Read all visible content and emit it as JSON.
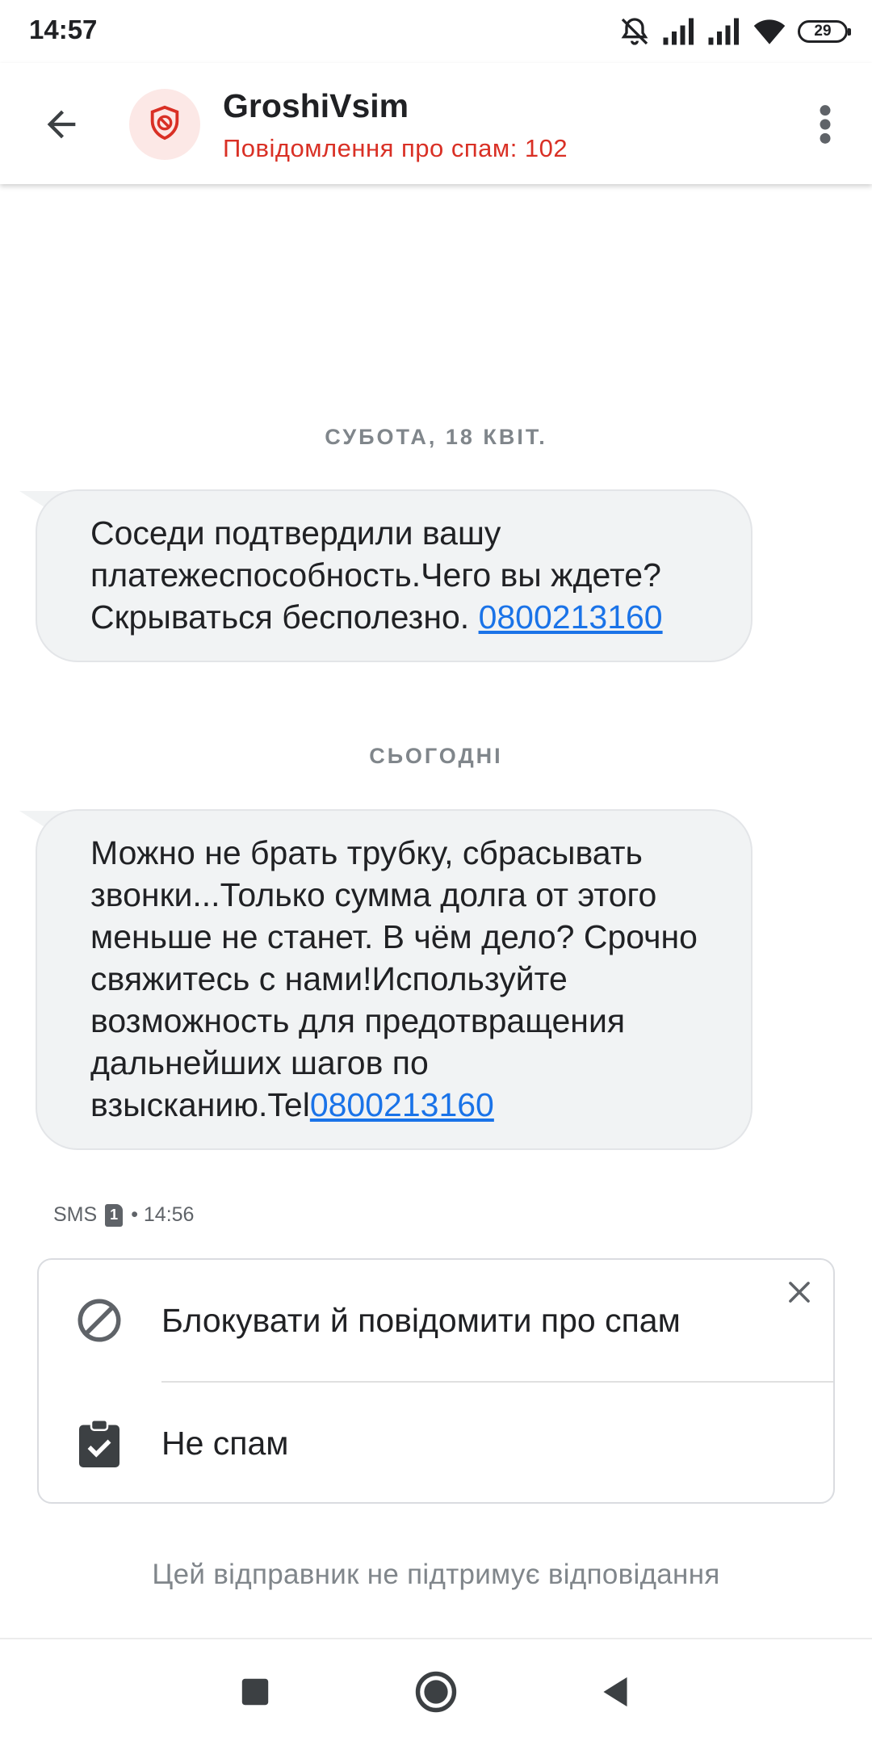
{
  "status_bar": {
    "time": "14:57",
    "battery": "29",
    "icons": [
      "alarm-off-icon",
      "signal-icon",
      "signal-icon",
      "wifi-icon",
      "battery-icon"
    ]
  },
  "app_bar": {
    "back_icon": "arrow-back-icon",
    "avatar_icon": "spam-shield-icon",
    "sender_name": "GroshiVsim",
    "spam_count": "Повідомлення про спам: 102",
    "menu_icon": "more-vert-icon"
  },
  "conversation": {
    "groups": [
      {
        "date": "СУБОТА, 18 КВІТ.",
        "message_text": "Соседи подтвердили вашу платежеспособность.Чего вы ждете?Скрываться бесполезно.",
        "message_link": "0800213160"
      },
      {
        "date": "СЬОГОДНІ",
        "message_text": "Можно не брать трубку, сбрасывать звонки...Только сумма долга от этого меньше не станет. В чём дело? Срочно свяжитесь с нами!Используйте возможность для предотвращения дальнейших шагов по взысканию.Tel",
        "message_link": "0800213160",
        "meta": {
          "type": "SMS",
          "sim": "1",
          "time": "• 14:56"
        }
      }
    ]
  },
  "spam_card": {
    "close_icon": "close-icon",
    "actions": [
      {
        "icon": "block-icon",
        "label": "Блокувати й повідомити про спам"
      },
      {
        "icon": "clipboard-check-icon",
        "label": "Не спам"
      }
    ]
  },
  "footer": {
    "no_reply_text": "Цей відправник не підтримує відповідання"
  },
  "nav_bar": {
    "buttons": [
      "recents-square-icon",
      "home-circle-icon",
      "back-triangle-icon"
    ]
  },
  "colors": {
    "spam_red": "#d93025",
    "avatar_bg": "#fce8e6",
    "link_blue": "#1a73e8",
    "bubble_bg": "#f1f3f4",
    "muted_text": "#80868b"
  }
}
